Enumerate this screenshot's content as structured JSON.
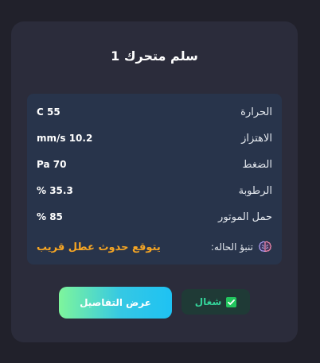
{
  "card": {
    "title": "سلم متحرك 1",
    "metrics": [
      {
        "label": "الحرارة",
        "value": "C 55"
      },
      {
        "label": "الاهتزاز",
        "value": "mm/s 10.2"
      },
      {
        "label": "الضغط",
        "value": "Pa 70"
      },
      {
        "label": "الرطوبة",
        "value": "% 35.3"
      },
      {
        "label": "حمل الموتور",
        "value": "% 85"
      }
    ],
    "prediction": {
      "label": "تنبؤ الحاله:",
      "value": "يتوقع حدوث عطل قريب",
      "icon": "brain-icon"
    },
    "details_button": "عرض التفاصيل",
    "status": {
      "label": "شغال",
      "icon": "check-box-icon"
    }
  },
  "colors": {
    "page_background": "#21212b",
    "card_background": "#2b2c3b",
    "panel_background": "#28344b",
    "prediction_warning": "#f5a524",
    "status_green": "#34d399",
    "button_gradient_start": "#7ef59c",
    "button_gradient_end": "#1ec2f3"
  }
}
